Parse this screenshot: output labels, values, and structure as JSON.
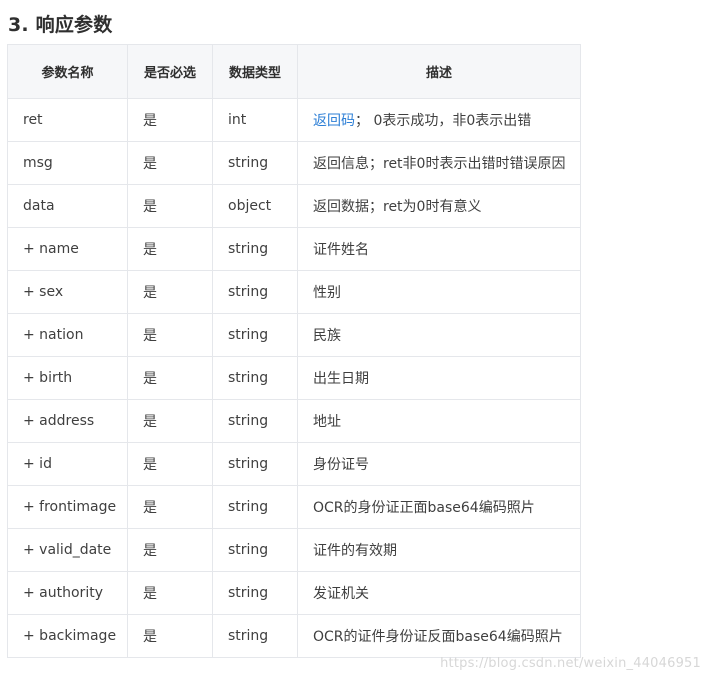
{
  "section": {
    "title": "3. 响应参数"
  },
  "table": {
    "headers": [
      "参数名称",
      "是否必选",
      "数据类型",
      "描述"
    ],
    "rows": [
      {
        "name": "ret",
        "required": "是",
        "type": "int",
        "desc_link": "返回码",
        "desc_text": "；  0表示成功，非0表示出错"
      },
      {
        "name": "msg",
        "required": "是",
        "type": "string",
        "desc_text": "返回信息；ret非0时表示出错时错误原因"
      },
      {
        "name": "data",
        "required": "是",
        "type": "object",
        "desc_text": "返回数据；ret为0时有意义"
      },
      {
        "name": "+ name",
        "required": "是",
        "type": "string",
        "desc_text": "证件姓名"
      },
      {
        "name": "+ sex",
        "required": "是",
        "type": "string",
        "desc_text": "性别"
      },
      {
        "name": "+ nation",
        "required": "是",
        "type": "string",
        "desc_text": "民族"
      },
      {
        "name": "+ birth",
        "required": "是",
        "type": "string",
        "desc_text": "出生日期"
      },
      {
        "name": "+ address",
        "required": "是",
        "type": "string",
        "desc_text": "地址"
      },
      {
        "name": "+ id",
        "required": "是",
        "type": "string",
        "desc_text": "身份证号"
      },
      {
        "name": "+ frontimage",
        "required": "是",
        "type": "string",
        "desc_text": "OCR的身份证正面base64编码照片"
      },
      {
        "name": "+ valid_date",
        "required": "是",
        "type": "string",
        "desc_text": "证件的有效期"
      },
      {
        "name": "+ authority",
        "required": "是",
        "type": "string",
        "desc_text": "发证机关"
      },
      {
        "name": "+ backimage",
        "required": "是",
        "type": "string",
        "desc_text": "OCR的证件身份证反面base64编码照片"
      }
    ]
  },
  "watermark": {
    "text": "https://blog.csdn.net/weixin_44046951"
  }
}
